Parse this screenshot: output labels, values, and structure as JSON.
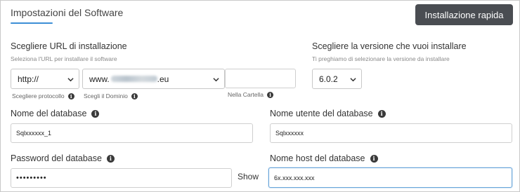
{
  "section": {
    "title": "Impostazioni del Software"
  },
  "quick_install": {
    "label": "Installazione rapida"
  },
  "url": {
    "label": "Scegliere URL di installazione",
    "hint": "Seleziona l'URL per installare il software",
    "protocol": {
      "value": "http://",
      "caption": "Scegliere protocollo"
    },
    "domain": {
      "value_prefix": "www.",
      "value_suffix": ".eu",
      "caption": "Scegli il Dominio"
    },
    "folder": {
      "value": "",
      "caption": "Nella Cartella"
    }
  },
  "version": {
    "label": "Scegliere la versione che vuoi installare",
    "hint": "Ti preghiamo di selezionare la versione da installare",
    "value": "6.0.2"
  },
  "db_name": {
    "label": "Nome del database",
    "value": "Sqlxxxxxx_1"
  },
  "db_user": {
    "label": "Nome utente del database",
    "value": "Sqlxxxxxx"
  },
  "db_password": {
    "label": "Password del database",
    "value": "•••••••••",
    "show_label": "Show"
  },
  "db_host": {
    "label": "Nome host del database",
    "value": "6x.xxx.xxx.xxx"
  },
  "colors": {
    "accent": "#3d8fd6",
    "button_bg": "#4a4d52",
    "focus_border": "#6aa6da"
  },
  "icons": {
    "info": "info-icon",
    "dropdown": "chevron-down-icon"
  }
}
